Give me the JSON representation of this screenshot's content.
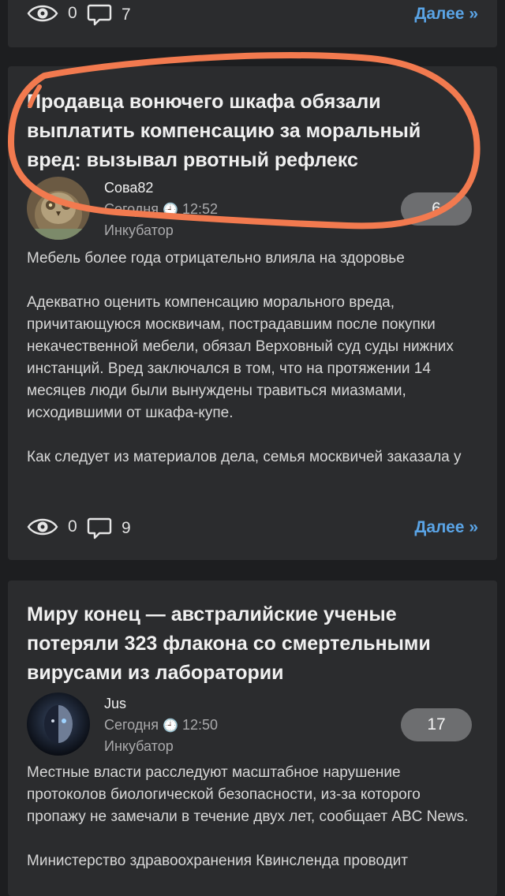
{
  "colors": {
    "background": "#1d1e20",
    "card": "#2b2c2e",
    "link": "#5aa4e6",
    "badge": "#6d6e70",
    "annotation": "#f27a4f"
  },
  "icons": {
    "views": "eye-icon",
    "comments": "speech-bubble-icon",
    "clock": "clock-icon"
  },
  "posts": [
    {
      "views": "0",
      "comments": "7",
      "more_label": "Далее »"
    },
    {
      "title": "Продавца вонючего шкафа обязали выплатить компенсацию за моральный вред: вызывал рвотный рефлекс",
      "author": "Сова82",
      "date": "Сегодня",
      "time": "12:52",
      "category": "Инкубатор",
      "rating": "6",
      "paragraphs": [
        "Мебель более года отрицательно влияла на здоровье",
        "Адекватно оценить компенсацию морального вреда, причитающуюся москвичам, пострадавшим после покупки некачественной мебели, обязал Верховный суд суды нижних инстанций. Вред заключался в том, что на протяжении 14 месяцев люди были вынуждены травиться миазмами, исходившими от шкафа-купе.",
        "Как следует из материалов дела, семья москвичей заказала у"
      ],
      "views": "0",
      "comments": "9",
      "more_label": "Далее »"
    },
    {
      "title": "Миру конец — австралийские ученые потеряли 323 флакона со смертельными вирусами из лаборатории",
      "author": "Jus",
      "date": "Сегодня",
      "time": "12:50",
      "category": "Инкубатор",
      "rating": "17",
      "paragraphs": [
        "Местные власти расследуют масштабное нарушение протоколов биологической безопасности, из-за которого пропажу не замечали в течение двух лет, сообщает ABC News.",
        "Министерство здравоохранения Квинсленда проводит"
      ]
    }
  ]
}
